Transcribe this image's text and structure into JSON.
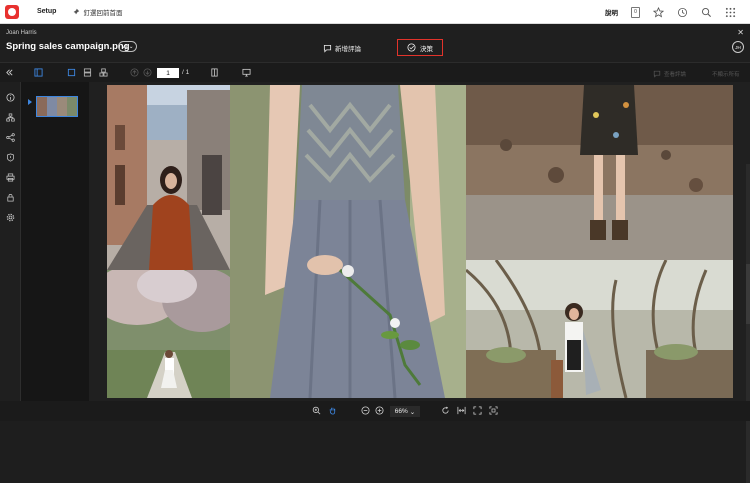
{
  "topbar": {
    "tab_setup": "Setup",
    "pinned_label": "釘選回前首面",
    "help_label": "說明",
    "notifications_count": "0"
  },
  "header": {
    "owner": "Joan Harris",
    "file_name": "Spring sales campaign.png",
    "version": "v1",
    "add_comment": "新增評論",
    "decision": "決策",
    "avatar_initials": "JH"
  },
  "toolbar": {
    "current_page": "1",
    "total_pages": "/ 1",
    "view_comments": "查看評論",
    "hide_all_comments": "不顯示所有"
  },
  "bottombar": {
    "zoom": "66%"
  },
  "colors": {
    "accent_blue": "#3d86e0",
    "decision_border": "#e2332b",
    "brand_red": "#e8312f"
  },
  "icons": {
    "topbar": [
      "app-logo-icon",
      "pin-icon",
      "notifications-icon",
      "star-icon",
      "history-icon",
      "search-icon",
      "apps-grid-icon"
    ],
    "sidebar": [
      "collapse-icon",
      "info-icon",
      "workflow-icon",
      "share-icon",
      "shield-icon",
      "print-icon",
      "lock-icon",
      "settings-icon"
    ],
    "bottombar": [
      "zoom-in-icon",
      "hand-icon",
      "zoom-out-icon",
      "zoom-plus-icon",
      "rotate-icon",
      "fit-width-icon",
      "fullscreen-icon",
      "fit-page-icon"
    ]
  }
}
